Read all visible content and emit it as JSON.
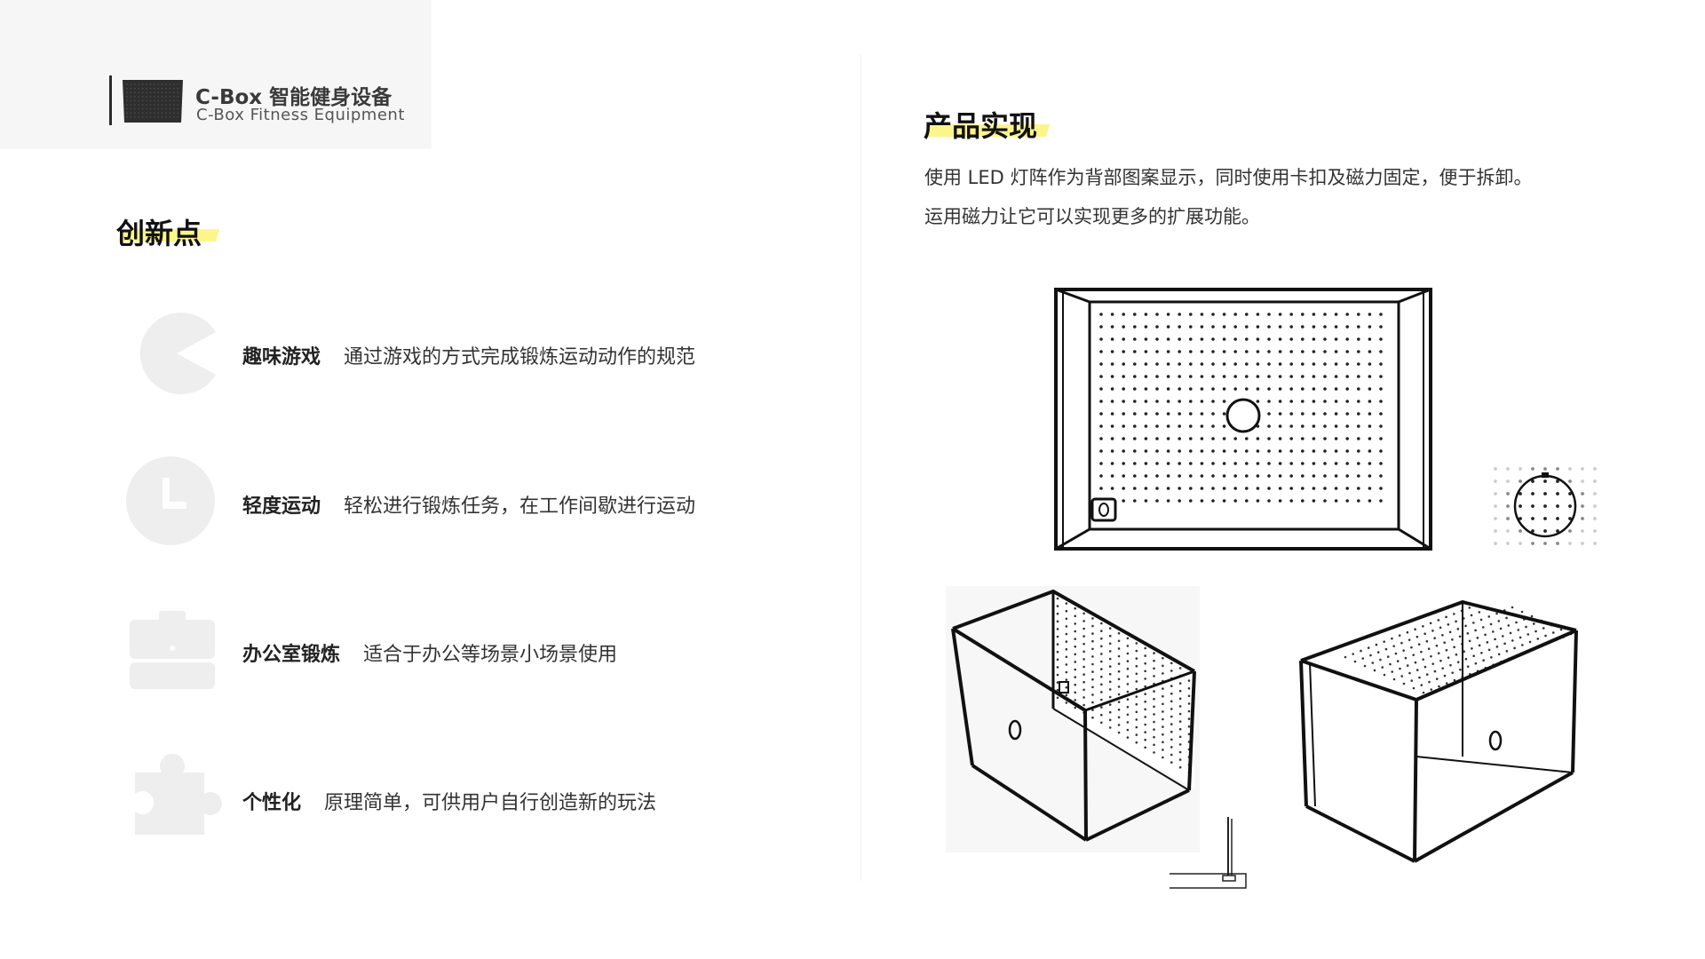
{
  "brand": {
    "title": "C-Box 智能健身设备",
    "subtitle": "C-Box Fitness Equipment"
  },
  "left": {
    "section_title": "创新点",
    "features": [
      {
        "icon": "pacman-icon",
        "name": "趣味游戏",
        "desc": "通过游戏的方式完成锻炼运动动作的规范"
      },
      {
        "icon": "clock-icon",
        "name": "轻度运动",
        "desc": "轻松进行锻炼任务，在工作间歇进行运动"
      },
      {
        "icon": "briefcase-icon",
        "name": "办公室锻炼",
        "desc": "适合于办公等场景小场景使用"
      },
      {
        "icon": "puzzle-icon",
        "name": "个性化",
        "desc": "原理简单，可供用户自行创造新的玩法"
      }
    ]
  },
  "right": {
    "section_title": "产品实现",
    "description": [
      "使用 LED 灯阵作为背部图案显示，同时使用卡扣及磁力固定，便于拆卸。",
      "运用磁力让它可以实现更多的扩展功能。"
    ]
  },
  "colors": {
    "highlight": "#fdf58a",
    "icon_gray": "#eeeeee",
    "logo_panel": "#f6f6f6"
  }
}
